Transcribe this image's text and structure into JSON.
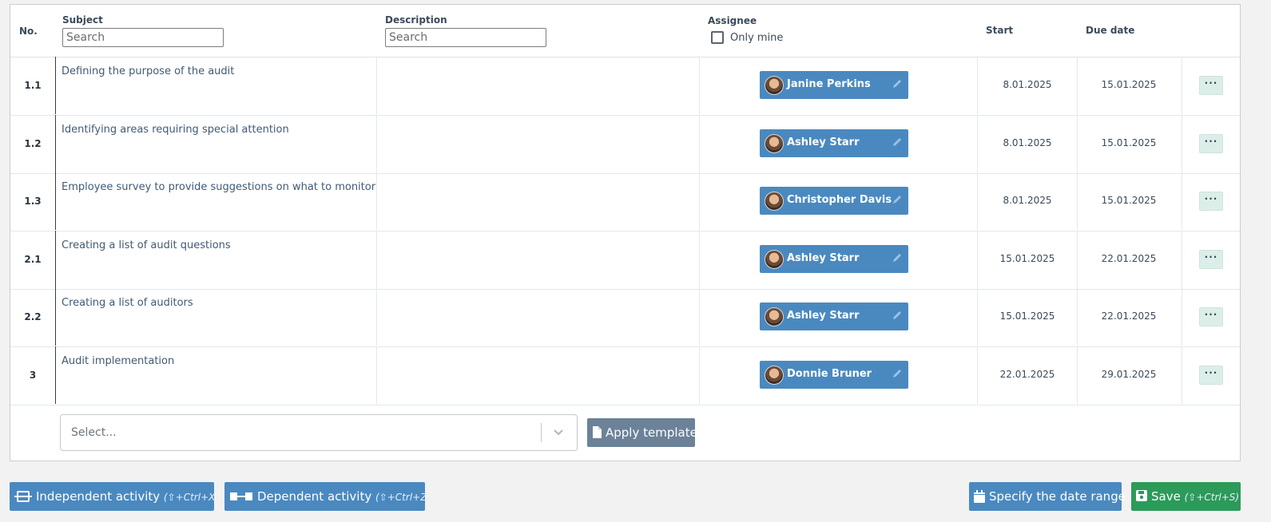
{
  "header": {
    "no_label": "No.",
    "subject_label": "Subject",
    "subject_search_placeholder": "Search",
    "description_label": "Description",
    "description_search_placeholder": "Search",
    "assignee_label": "Assignee",
    "only_mine_label": "Only mine",
    "start_label": "Start",
    "due_label": "Due date"
  },
  "rows": [
    {
      "no": "1.1",
      "subject": "Defining the purpose of the audit",
      "assignee": "Janine Perkins",
      "start": "8.01.2025",
      "due": "15.01.2025",
      "more": "···"
    },
    {
      "no": "1.2",
      "subject": "Identifying areas requiring special attention",
      "assignee": "Ashley Starr",
      "start": "8.01.2025",
      "due": "15.01.2025",
      "more": "···"
    },
    {
      "no": "1.3",
      "subject": "Employee survey to provide suggestions on what to monitor",
      "assignee": "Christopher Davis",
      "start": "8.01.2025",
      "due": "15.01.2025",
      "more": "···"
    },
    {
      "no": "2.1",
      "subject": "Creating a list of audit questions",
      "assignee": "Ashley Starr",
      "start": "15.01.2025",
      "due": "22.01.2025",
      "more": "···"
    },
    {
      "no": "2.2",
      "subject": "Creating a list of auditors",
      "assignee": "Ashley Starr",
      "start": "15.01.2025",
      "due": "22.01.2025",
      "more": "···"
    },
    {
      "no": "3",
      "subject": "Audit implementation",
      "assignee": "Donnie Bruner",
      "start": "22.01.2025",
      "due": "29.01.2025",
      "more": "···"
    }
  ],
  "template": {
    "select_placeholder": "Select...",
    "apply_label": "Apply template"
  },
  "footer": {
    "independent_label": "Independent activity",
    "independent_shortcut": "(⇧+Ctrl+X)",
    "dependent_label": "Dependent activity",
    "dependent_shortcut": "(⇧+Ctrl+Z)",
    "date_range_label": "Specify the date range",
    "save_label": "Save",
    "save_shortcut": "(⇧+Ctrl+S)"
  },
  "colors": {
    "primary_blue": "#4a89c0",
    "save_green": "#2c9a59",
    "template_gray": "#6b8299",
    "more_bg": "#dceee8"
  }
}
